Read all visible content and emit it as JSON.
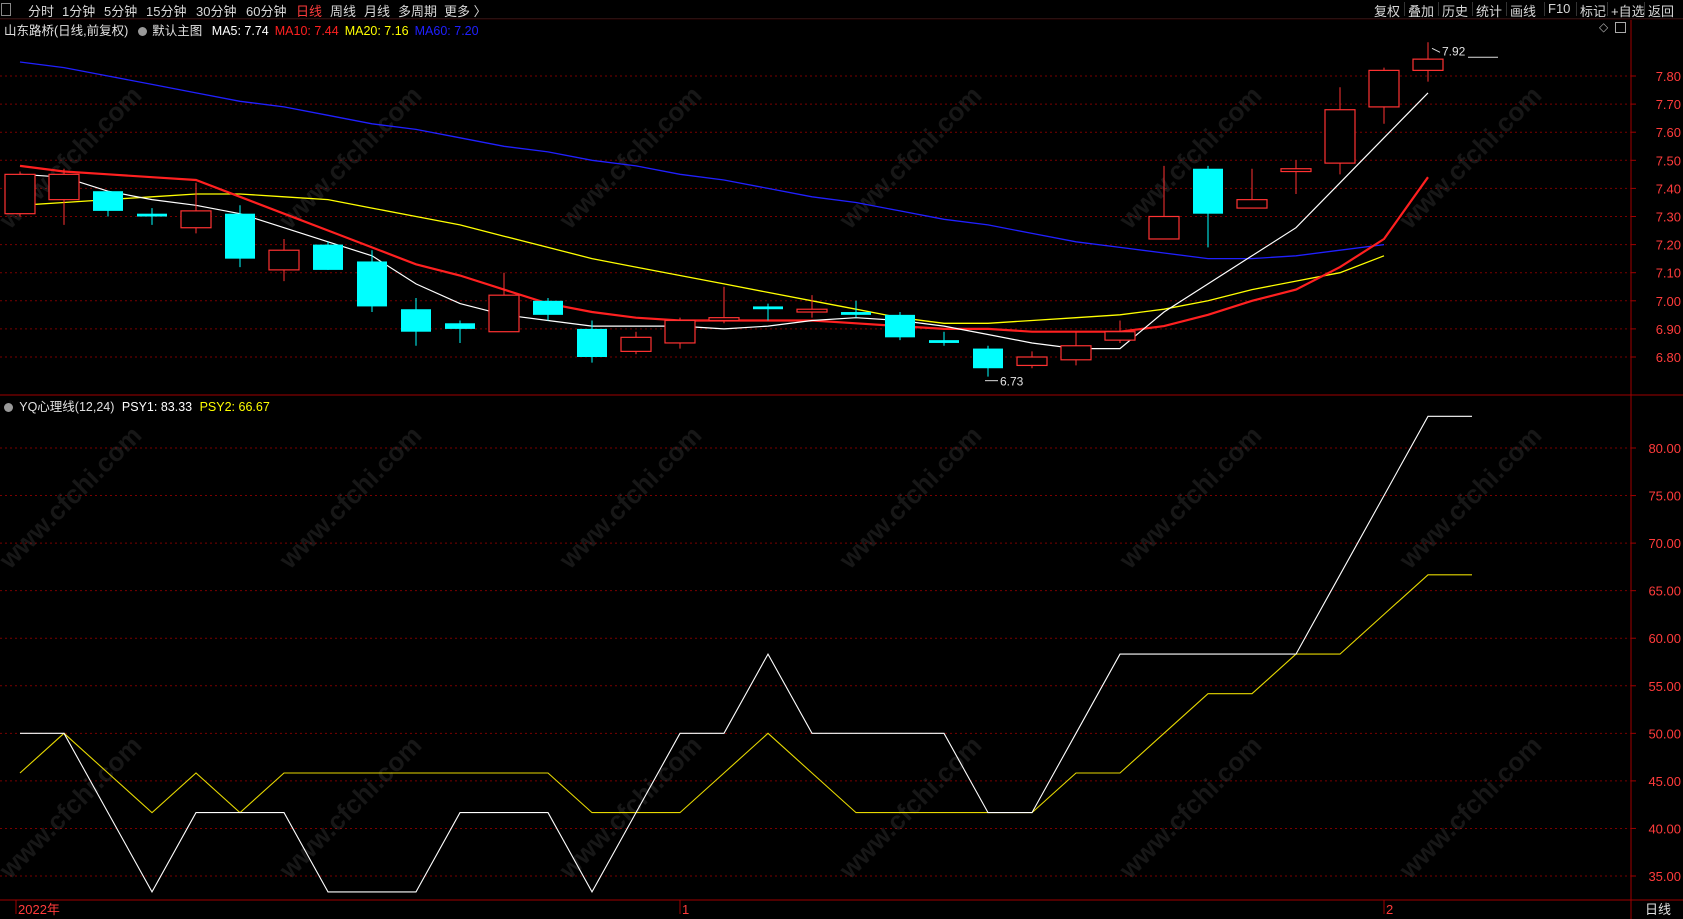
{
  "toolbar": {
    "periods": [
      "分时",
      "1分钟",
      "5分钟",
      "15分钟",
      "30分钟",
      "60分钟",
      "日线",
      "周线",
      "月线",
      "多周期",
      "更多 〉"
    ],
    "active_period": "日线",
    "right_buttons": [
      "复权",
      "叠加",
      "历史",
      "统计",
      "画线",
      "F10",
      "标记",
      "+自选",
      "返回"
    ]
  },
  "main_chart": {
    "title": "山东路桥(日线,前复权)",
    "template_label": "默认主图",
    "ma_labels": [
      {
        "text": "MA5: 7.74",
        "color": "#ffffff"
      },
      {
        "text": "MA10: 7.44",
        "color": "#ff2020"
      },
      {
        "text": "MA20: 7.16",
        "color": "#ffff00"
      },
      {
        "text": "MA60: 7.20",
        "color": "#2020ff"
      }
    ],
    "price_axis": [
      "7.80",
      "7.70",
      "7.60",
      "7.50",
      "7.40",
      "7.30",
      "7.20",
      "7.10",
      "7.00",
      "6.90",
      "6.80"
    ],
    "high_label": "7.92",
    "low_label": "6.73"
  },
  "indicator": {
    "title": "YQ心理线(12,24)",
    "psy1_label": "PSY1: 83.33",
    "psy2_label": "PSY2: 66.67",
    "axis": [
      "80.00",
      "75.00",
      "70.00",
      "65.00",
      "60.00",
      "55.00",
      "50.00",
      "45.00",
      "40.00",
      "35.00"
    ]
  },
  "date_axis": {
    "labels": [
      "2022年",
      "1",
      "2"
    ],
    "period_label": "日线"
  },
  "watermark": "www.cfchi.com",
  "colors": {
    "up": "#ff3232",
    "down": "#00ffff",
    "ma5": "#ffffff",
    "ma10": "#ff2020",
    "ma20": "#ffff00",
    "ma60": "#2020ff",
    "grid": "#7a0000",
    "axis_text": "#ff3b3b"
  },
  "chart_data": [
    {
      "type": "candlestick",
      "title": "山东路桥(日线,前复权)",
      "ylim": [
        6.7,
        7.92
      ],
      "candles": [
        {
          "o": 7.31,
          "c": 7.45,
          "h": 7.46,
          "l": 7.3
        },
        {
          "o": 7.36,
          "c": 7.45,
          "h": 7.47,
          "l": 7.27
        },
        {
          "o": 7.39,
          "c": 7.32,
          "h": 7.39,
          "l": 7.3
        },
        {
          "o": 7.31,
          "c": 7.3,
          "h": 7.33,
          "l": 7.27
        },
        {
          "o": 7.26,
          "c": 7.32,
          "h": 7.42,
          "l": 7.24
        },
        {
          "o": 7.31,
          "c": 7.15,
          "h": 7.34,
          "l": 7.12
        },
        {
          "o": 7.11,
          "c": 7.18,
          "h": 7.22,
          "l": 7.07
        },
        {
          "o": 7.2,
          "c": 7.11,
          "h": 7.21,
          "l": 7.11
        },
        {
          "o": 7.14,
          "c": 6.98,
          "h": 7.18,
          "l": 6.96
        },
        {
          "o": 6.97,
          "c": 6.89,
          "h": 7.01,
          "l": 6.84
        },
        {
          "o": 6.92,
          "c": 6.9,
          "h": 6.93,
          "l": 6.85
        },
        {
          "o": 6.89,
          "c": 7.02,
          "h": 7.1,
          "l": 6.89
        },
        {
          "o": 7.0,
          "c": 6.95,
          "h": 7.01,
          "l": 6.93
        },
        {
          "o": 6.9,
          "c": 6.8,
          "h": 6.93,
          "l": 6.78
        },
        {
          "o": 6.82,
          "c": 6.87,
          "h": 6.89,
          "l": 6.81
        },
        {
          "o": 6.85,
          "c": 6.93,
          "h": 6.94,
          "l": 6.83
        },
        {
          "o": 6.93,
          "c": 6.94,
          "h": 7.05,
          "l": 6.92
        },
        {
          "o": 6.98,
          "c": 6.97,
          "h": 6.99,
          "l": 6.93
        },
        {
          "o": 6.96,
          "c": 6.97,
          "h": 7.02,
          "l": 6.94
        },
        {
          "o": 6.96,
          "c": 6.95,
          "h": 7.0,
          "l": 6.94
        },
        {
          "o": 6.95,
          "c": 6.87,
          "h": 6.96,
          "l": 6.86
        },
        {
          "o": 6.86,
          "c": 6.85,
          "h": 6.89,
          "l": 6.84
        },
        {
          "o": 6.83,
          "c": 6.76,
          "h": 6.84,
          "l": 6.73
        },
        {
          "o": 6.77,
          "c": 6.8,
          "h": 6.82,
          "l": 6.76
        },
        {
          "o": 6.79,
          "c": 6.84,
          "h": 6.89,
          "l": 6.77
        },
        {
          "o": 6.86,
          "c": 6.89,
          "h": 6.93,
          "l": 6.85
        },
        {
          "o": 7.22,
          "c": 7.3,
          "h": 7.48,
          "l": 7.22
        },
        {
          "o": 7.47,
          "c": 7.31,
          "h": 7.48,
          "l": 7.19
        },
        {
          "o": 7.33,
          "c": 7.36,
          "h": 7.47,
          "l": 7.33
        },
        {
          "o": 7.46,
          "c": 7.47,
          "h": 7.5,
          "l": 7.38
        },
        {
          "o": 7.49,
          "c": 7.68,
          "h": 7.76,
          "l": 7.45
        },
        {
          "o": 7.69,
          "c": 7.82,
          "h": 7.83,
          "l": 7.63
        },
        {
          "o": 7.82,
          "c": 7.86,
          "h": 7.92,
          "l": 7.78
        }
      ],
      "ma5": [
        7.45,
        7.44,
        7.39,
        7.36,
        7.34,
        7.31,
        7.26,
        7.21,
        7.16,
        7.06,
        6.99,
        6.95,
        6.93,
        6.91,
        6.91,
        6.91,
        6.9,
        6.91,
        6.93,
        6.94,
        6.93,
        6.91,
        6.88,
        6.85,
        6.83,
        6.83,
        6.96,
        7.06,
        7.16,
        7.26,
        7.42,
        7.58,
        7.74
      ],
      "ma10": [
        7.48,
        7.46,
        7.45,
        7.44,
        7.43,
        7.37,
        7.31,
        7.25,
        7.19,
        7.13,
        7.09,
        7.04,
        6.99,
        6.96,
        6.94,
        6.93,
        6.93,
        6.93,
        6.93,
        6.92,
        6.91,
        6.9,
        6.9,
        6.89,
        6.89,
        6.89,
        6.91,
        6.95,
        7.0,
        7.04,
        7.12,
        7.22,
        7.44
      ],
      "ma20": [
        7.34,
        7.35,
        7.36,
        7.37,
        7.38,
        7.38,
        7.37,
        7.36,
        7.33,
        7.3,
        7.27,
        7.23,
        7.19,
        7.15,
        7.12,
        7.09,
        7.06,
        7.03,
        7.0,
        6.97,
        6.94,
        6.92,
        6.92,
        6.93,
        6.94,
        6.95,
        6.97,
        7.0,
        7.04,
        7.07,
        7.1,
        7.16
      ],
      "ma60": [
        7.85,
        7.83,
        7.8,
        7.77,
        7.74,
        7.71,
        7.69,
        7.66,
        7.63,
        7.61,
        7.58,
        7.55,
        7.53,
        7.5,
        7.48,
        7.45,
        7.43,
        7.4,
        7.37,
        7.35,
        7.32,
        7.29,
        7.27,
        7.24,
        7.21,
        7.19,
        7.17,
        7.15,
        7.15,
        7.16,
        7.18,
        7.2
      ]
    },
    {
      "type": "line",
      "title": "YQ心理线(12,24)",
      "ylim": [
        33.5,
        84.5
      ],
      "series": [
        {
          "name": "PSY1",
          "values": [
            50.0,
            50.0,
            41.67,
            33.33,
            41.67,
            41.67,
            41.67,
            33.33,
            33.33,
            33.33,
            41.67,
            41.67,
            41.67,
            33.33,
            41.67,
            50.0,
            50.0,
            58.33,
            50.0,
            50.0,
            50.0,
            50.0,
            41.67,
            41.67,
            50.0,
            58.33,
            58.33,
            58.33,
            58.33,
            58.33,
            66.67,
            75.0,
            83.33,
            83.33
          ]
        },
        {
          "name": "PSY2",
          "values": [
            45.83,
            50.0,
            45.83,
            41.67,
            45.83,
            41.67,
            45.83,
            45.83,
            45.83,
            45.83,
            45.83,
            45.83,
            45.83,
            41.67,
            41.67,
            41.67,
            45.83,
            50.0,
            45.83,
            41.67,
            41.67,
            41.67,
            41.67,
            41.67,
            45.83,
            45.83,
            50.0,
            54.17,
            54.17,
            58.33,
            58.33,
            62.5,
            66.67,
            66.67
          ]
        }
      ]
    }
  ]
}
